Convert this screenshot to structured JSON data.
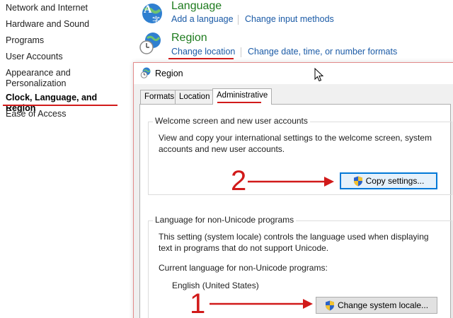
{
  "sidebar": {
    "items": [
      {
        "label": "Network and Internet"
      },
      {
        "label": "Hardware and Sound"
      },
      {
        "label": "Programs"
      },
      {
        "label": "User Accounts"
      },
      {
        "label": "Appearance and"
      },
      {
        "label": "Personalization"
      },
      {
        "label": "Clock, Language, and Region"
      },
      {
        "label": "Ease of Access"
      }
    ]
  },
  "categories": {
    "language": {
      "title": "Language",
      "icon": "language-icon",
      "links": [
        "Add a language",
        "Change input methods"
      ]
    },
    "region": {
      "title": "Region",
      "icon": "region-globe-clock-icon",
      "links": [
        "Change location",
        "Change date, time, or number formats"
      ]
    }
  },
  "dialog": {
    "title": "Region",
    "tabs": [
      "Formats",
      "Location",
      "Administrative"
    ],
    "active_tab": "Administrative",
    "welcome_group": {
      "title": "Welcome screen and new user accounts",
      "line1": "View and copy your international settings to the welcome screen, system",
      "line2": "accounts and new user accounts.",
      "button": "Copy settings..."
    },
    "unicode_group": {
      "title": "Language for non-Unicode programs",
      "line1": "This setting (system locale) controls the language used when displaying",
      "line2": "text in programs that do not support Unicode.",
      "current_label": "Current language for non-Unicode programs:",
      "current_value": "English (United States)",
      "button": "Change system locale..."
    }
  },
  "annotations": {
    "step1": "1",
    "step2": "2"
  },
  "colors": {
    "accent_red": "#d11a1a",
    "link_blue": "#1a5aa6",
    "category_green": "#1e7b1e"
  }
}
